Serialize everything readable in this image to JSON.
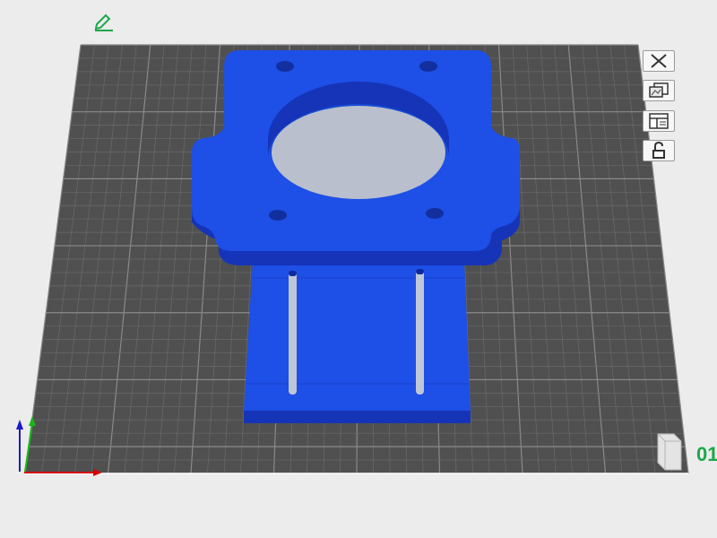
{
  "viewer": {
    "corner_label": "01"
  },
  "toolbar": {
    "items": [
      {
        "name": "close",
        "icon": "close-icon"
      },
      {
        "name": "screenshot",
        "icon": "image-edit-icon"
      },
      {
        "name": "layout",
        "icon": "layout-panel-icon"
      },
      {
        "name": "lock",
        "icon": "lock-open-icon"
      }
    ]
  },
  "colors": {
    "bed": "#505050",
    "grid_minor": "#6a6a6a",
    "grid_major": "#8a8a8a",
    "model": "#1e4fe6",
    "model_side": "#1634b8",
    "axis_x": "#d40000",
    "axis_y": "#18b818",
    "axis_z": "#1a1ac8",
    "accent": "#1ca84b"
  }
}
